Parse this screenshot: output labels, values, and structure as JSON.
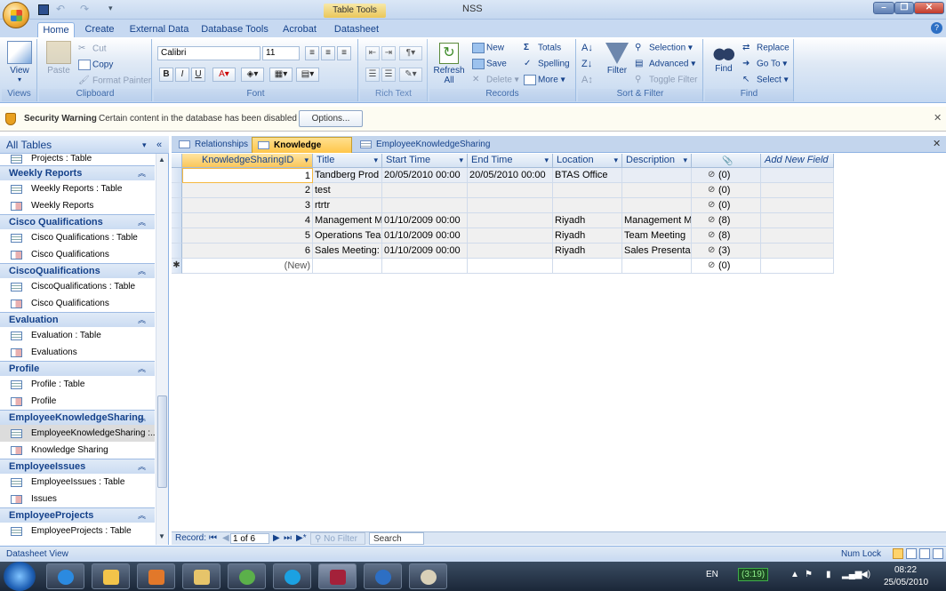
{
  "window": {
    "title": "NSS",
    "context_tab": "Table Tools"
  },
  "ribbon_tabs": [
    "Home",
    "Create",
    "External Data",
    "Database Tools",
    "Acrobat",
    "Datasheet"
  ],
  "ribbon": {
    "views": {
      "label": "Views",
      "view_btn": "View"
    },
    "clipboard": {
      "label": "Clipboard",
      "paste": "Paste",
      "cut": "Cut",
      "copy": "Copy",
      "format_painter": "Format Painter"
    },
    "font": {
      "label": "Font",
      "family": "Calibri",
      "size": "11"
    },
    "rich_text": {
      "label": "Rich Text"
    },
    "records": {
      "label": "Records",
      "refresh": "Refresh",
      "refresh_all": "All",
      "new": "New",
      "save": "Save",
      "delete": "Delete",
      "totals": "Totals",
      "spelling": "Spelling",
      "more": "More"
    },
    "sort_filter": {
      "label": "Sort & Filter",
      "filter": "Filter",
      "selection": "Selection",
      "advanced": "Advanced",
      "toggle_filter": "Toggle Filter"
    },
    "find": {
      "label": "Find",
      "find": "Find",
      "replace": "Replace",
      "go_to": "Go To",
      "select": "Select"
    }
  },
  "security": {
    "title": "Security Warning",
    "message": "Certain content in the database has been disabled",
    "options": "Options..."
  },
  "nav": {
    "header": "All Tables",
    "top_item": "Projects : Table",
    "groups": [
      {
        "name": "Weekly Reports",
        "items": [
          "Weekly Reports : Table",
          "Weekly Reports"
        ]
      },
      {
        "name": "Cisco Qualifications",
        "items": [
          "Cisco Qualifications : Table",
          "Cisco Qualifications"
        ]
      },
      {
        "name": "CiscoQualifications",
        "items": [
          "CiscoQualifications : Table",
          "Cisco Qualifications"
        ]
      },
      {
        "name": "Evaluation",
        "items": [
          "Evaluation : Table",
          "Evaluations"
        ]
      },
      {
        "name": "Profile",
        "items": [
          "Profile : Table",
          "Profile"
        ]
      },
      {
        "name": "EmployeeKnowledgeSharing",
        "items": [
          "EmployeeKnowledgeSharing :...",
          "Knowledge Sharing"
        ]
      },
      {
        "name": "EmployeeIssues",
        "items": [
          "EmployeeIssues : Table",
          "Issues"
        ]
      },
      {
        "name": "EmployeeProjects",
        "items": [
          "EmployeeProjects : Table"
        ]
      }
    ]
  },
  "doc_tabs": [
    "Relationships",
    "Knowledge Sharing",
    "EmployeeKnowledgeSharing"
  ],
  "grid": {
    "columns": [
      "KnowledgeSharingID",
      "Title",
      "Start Time",
      "End Time",
      "Location",
      "Description",
      "",
      "Add New Field"
    ],
    "rows": [
      [
        "1",
        "Tandberg Prod",
        "20/05/2010 00:00",
        "20/05/2010 00:00",
        "BTAS Office",
        "",
        "(0)"
      ],
      [
        "2",
        "test",
        "",
        "",
        "",
        "",
        "(0)"
      ],
      [
        "3",
        "rtrtr",
        "",
        "",
        "",
        "",
        "(0)"
      ],
      [
        "4",
        "Management M",
        "01/10/2009 00:00",
        "",
        "Riyadh",
        "Management M",
        "(8)"
      ],
      [
        "5",
        "Operations Tea",
        "01/10/2009 00:00",
        "",
        "Riyadh",
        "Team Meeting",
        "(8)"
      ],
      [
        "6",
        "Sales Meeting:",
        "01/10/2009 00:00",
        "",
        "Riyadh",
        "Sales Presenta",
        "(3)"
      ]
    ],
    "new_row": {
      "id": "(New)",
      "att": "(0)"
    }
  },
  "record_nav": {
    "label": "Record:",
    "position": "1 of 6",
    "no_filter": "No Filter",
    "search": "Search"
  },
  "status": {
    "left": "Datasheet View",
    "right": "Num Lock"
  },
  "taskbar": {
    "lang": "EN",
    "battery": "(3:19)",
    "time": "08:22",
    "date": "25/05/2010"
  },
  "colors": {
    "accent": "#15428b",
    "selected_tab": "#ffc64a",
    "ribbon": "#c4d8f1"
  }
}
